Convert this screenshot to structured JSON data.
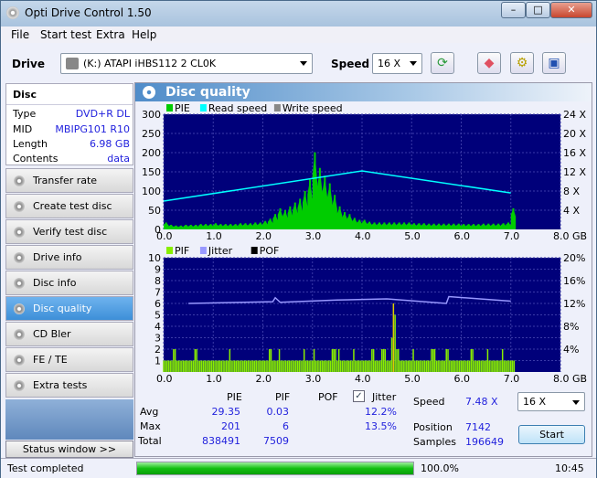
{
  "window": {
    "title": "Opti Drive Control 1.50",
    "min": "–",
    "max": "□",
    "close": "✕"
  },
  "menu": [
    "File",
    "Start test",
    "Extra",
    "Help"
  ],
  "toolbar": {
    "drive_label": "Drive",
    "drive_value": "(K:)   ATAPI iHBS112   2 CL0K",
    "speed_label": "Speed",
    "speed_value": "16 X",
    "icons": [
      "refresh-icon",
      "eraser-icon",
      "settings-icon",
      "save-icon"
    ]
  },
  "disc": {
    "header": "Disc",
    "rows": [
      {
        "k": "Type",
        "v": "DVD+R DL"
      },
      {
        "k": "MID",
        "v": "MBIPG101 R10"
      },
      {
        "k": "Length",
        "v": "6.98 GB"
      },
      {
        "k": "Contents",
        "v": "data"
      }
    ]
  },
  "nav": [
    "Transfer rate",
    "Create test disc",
    "Verify test disc",
    "Drive info",
    "Disc info",
    "Disc quality",
    "CD Bler",
    "FE / TE",
    "Extra tests"
  ],
  "nav_selected": "Disc quality",
  "status_window": "Status window >>",
  "panel_title": "Disc quality",
  "chart_data": [
    {
      "type": "bar",
      "legend": [
        "PIE",
        "Read speed",
        "Write speed"
      ],
      "colors": {
        "PIE": "#00cc00",
        "Read speed": "#00ffff",
        "Write speed": "#888888",
        "bg": "#00007a"
      },
      "xlim": [
        0,
        8
      ],
      "xticks": [
        "0.0",
        "1.0",
        "2.0",
        "3.0",
        "4.0",
        "5.0",
        "6.0",
        "7.0",
        "8.0 GB"
      ],
      "ylim": [
        0,
        300
      ],
      "yticks": [
        "0",
        "50",
        "100",
        "150",
        "200",
        "250",
        "300"
      ],
      "y2lim": [
        0,
        24
      ],
      "y2ticks": [
        "4 X",
        "8 X",
        "12 X",
        "16 X",
        "20 X",
        "24 X"
      ],
      "x_step": 0.1,
      "pie": [
        18,
        12,
        10,
        10,
        12,
        12,
        12,
        14,
        14,
        14,
        16,
        14,
        14,
        14,
        14,
        16,
        16,
        16,
        18,
        18,
        22,
        28,
        40,
        55,
        50,
        60,
        70,
        80,
        100,
        130,
        201,
        160,
        140,
        120,
        90,
        60,
        45,
        40,
        30,
        25,
        25,
        20,
        18,
        18,
        18,
        18,
        18,
        18,
        18,
        18,
        16,
        16,
        16,
        15,
        15,
        15,
        15,
        15,
        15,
        15,
        14,
        14,
        14,
        14,
        15,
        15,
        15,
        15,
        16,
        18,
        55
      ],
      "read_speed": [
        [
          0,
          5.9
        ],
        [
          4.0,
          12.2
        ],
        [
          7.0,
          7.6
        ]
      ]
    },
    {
      "type": "bar",
      "legend": [
        "PIF",
        "Jitter",
        "POF"
      ],
      "colors": {
        "PIF": "#88ee00",
        "Jitter": "#9999ff",
        "POF": "#000000",
        "bg": "#00007a"
      },
      "xlim": [
        0,
        8
      ],
      "xticks": [
        "0.0",
        "1.0",
        "2.0",
        "3.0",
        "4.0",
        "5.0",
        "6.0",
        "7.0",
        "8.0 GB"
      ],
      "ylim": [
        0,
        10
      ],
      "yticks": [
        "1",
        "2",
        "3",
        "4",
        "5",
        "6",
        "7",
        "8",
        "9",
        "10"
      ],
      "y2lim": [
        0,
        20
      ],
      "y2ticks": [
        "4%",
        "8%",
        "12%",
        "16%",
        "20%"
      ],
      "x_step": 0.1,
      "pif": [
        1,
        1,
        2,
        1,
        1,
        1,
        2,
        1,
        1,
        1,
        1,
        1,
        1,
        2,
        1,
        1,
        1,
        1,
        1,
        1,
        1,
        2,
        1,
        2,
        1,
        1,
        1,
        1,
        2,
        1,
        2,
        1,
        1,
        1,
        2,
        2,
        1,
        1,
        2,
        1,
        1,
        1,
        2,
        1,
        2,
        1,
        6,
        2,
        1,
        1,
        2,
        1,
        1,
        1,
        2,
        1,
        1,
        2,
        1,
        1,
        1,
        1,
        2,
        1,
        1,
        2,
        1,
        1,
        2,
        1,
        1
      ],
      "jitter": [
        [
          0.5,
          12.0
        ],
        [
          2.2,
          12.3
        ],
        [
          2.25,
          13.0
        ],
        [
          2.35,
          12.2
        ],
        [
          3.5,
          12.6
        ],
        [
          4.5,
          12.8
        ],
        [
          5.7,
          12.0
        ],
        [
          5.75,
          13.2
        ],
        [
          7.0,
          12.4
        ]
      ]
    }
  ],
  "stats": {
    "headers": [
      "PIE",
      "PIF",
      "POF",
      "Jitter"
    ],
    "jitter_checked": true,
    "avg_label": "Avg",
    "max_label": "Max",
    "total_label": "Total",
    "avg": {
      "pie": "29.35",
      "pif": "0.03",
      "jitter": "12.2%"
    },
    "max": {
      "pie": "201",
      "pif": "6",
      "jitter": "13.5%"
    },
    "total": {
      "pie": "838491",
      "pif": "7509"
    },
    "speed_label": "Speed",
    "speed": "7.48 X",
    "position_label": "Position",
    "position": "7142",
    "samples_label": "Samples",
    "samples": "196649",
    "speed_select": "16 X",
    "start": "Start"
  },
  "statusbar": {
    "text": "Test completed",
    "progress": 100.0,
    "progress_text": "100.0%",
    "time": "10:45"
  }
}
